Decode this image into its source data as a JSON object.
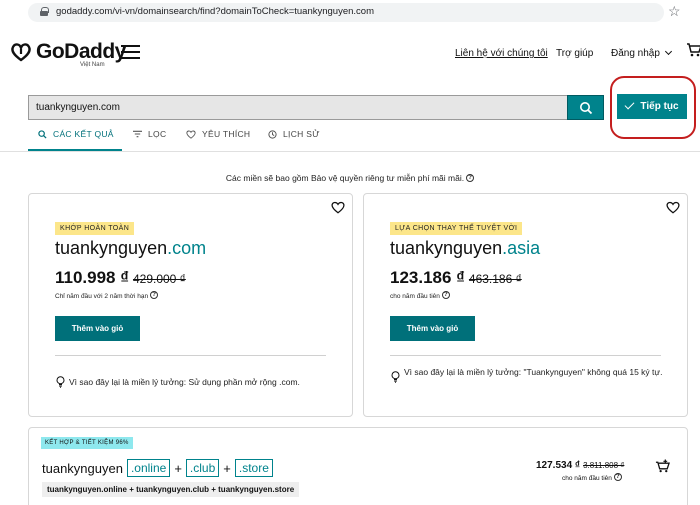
{
  "browser": {
    "url": "godaddy.com/vi-vn/domainsearch/find?domainToCheck=tuankynguyen.com"
  },
  "header": {
    "logo_text": "GoDaddy",
    "logo_sub": "Việt Nam",
    "contact_label": "Liên hệ với chúng tôi",
    "help_label": "Trợ giúp",
    "login_label": "Đăng nhập"
  },
  "search": {
    "value": "tuankynguyen.com",
    "continue_label": "Tiếp tục"
  },
  "tabs": [
    {
      "label": "CÁC KẾT QUẢ"
    },
    {
      "label": "LỌC"
    },
    {
      "label": "YÊU THÍCH"
    },
    {
      "label": "LỊCH SỬ"
    }
  ],
  "notice": "Các miền sẽ bao gồm Bảo vệ quyền riêng tư miễn phí mãi mãi.",
  "cards": [
    {
      "badge": "KHỚP HOÀN TOÀN",
      "sld": "tuankynguyen",
      "tld": ".com",
      "price": "110.998 ₫",
      "old_price": "429.000 ₫",
      "note": "Chỉ năm đầu với 2 năm thời hạn",
      "button": "Thêm vào giỏ",
      "reason": "Vì sao đây lại là miền lý tưởng: Sử dụng phần mở rộng .com."
    },
    {
      "badge": "LỰA CHỌN THAY THẾ TUYỆT VỜI",
      "sld": "tuankynguyen",
      "tld": ".asia",
      "price": "123.186 ₫",
      "old_price": "463.186 ₫",
      "note": "cho năm đầu tiên",
      "button": "Thêm vào giỏ",
      "reason": "Vì sao đây lại là miền lý tưởng: \"Tuankynguyen\" không quá 15 ký tự."
    }
  ],
  "bundle": {
    "badge": "KẾT HỢP & TIẾT KIỆM 96%",
    "base": "tuankynguyen",
    "tlds": [
      ".online",
      ".club",
      ".store"
    ],
    "plus": "+",
    "list": "tuankynguyen.online + tuankynguyen.club + tuankynguyen.store",
    "price": "127.534 ₫",
    "old_price": "3.811.808 ₫",
    "note": "cho năm đầu tiên"
  },
  "colors": {
    "accent": "#00838c",
    "badge_yellow": "#fce68a",
    "badge_cyan": "#8ee8ee",
    "highlight_ring": "#c41e1e"
  }
}
